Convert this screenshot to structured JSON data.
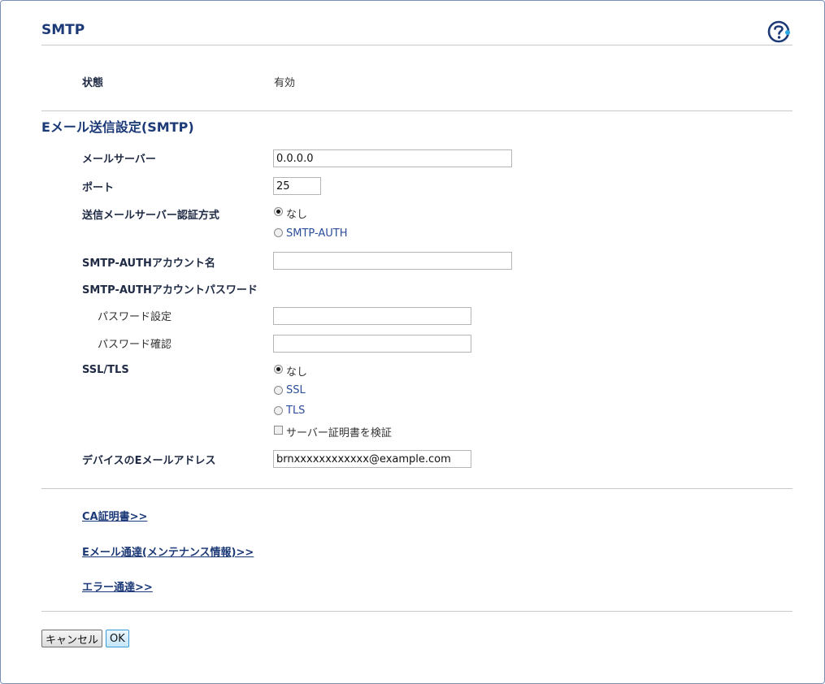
{
  "page": {
    "title": "SMTP",
    "help_icon": "help-question-icon"
  },
  "status": {
    "label": "状態",
    "value": "有効"
  },
  "section": {
    "title": "Eメール送信設定(SMTP)"
  },
  "form": {
    "mail_server": {
      "label": "メールサーバー",
      "value": "0.0.0.0"
    },
    "port": {
      "label": "ポート",
      "value": "25"
    },
    "auth_method": {
      "label": "送信メールサーバー認証方式",
      "options": [
        "なし",
        "SMTP-AUTH"
      ],
      "selected": "なし"
    },
    "auth_account": {
      "label": "SMTP-AUTHアカウント名",
      "value": ""
    },
    "auth_password": {
      "label": "SMTP-AUTHアカウントパスワード",
      "set_label": "パスワード設定",
      "confirm_label": "パスワード確認",
      "set_value": "",
      "confirm_value": ""
    },
    "ssl_tls": {
      "label": "SSL/TLS",
      "options": [
        "なし",
        "SSL",
        "TLS"
      ],
      "selected": "なし",
      "verify_cert_label": "サーバー証明書を検証",
      "verify_cert_checked": false
    },
    "device_email": {
      "label": "デバイスのEメールアドレス",
      "value": "brnxxxxxxxxxxxx@example.com"
    }
  },
  "links": {
    "ca_cert": "CA証明書>>",
    "email_report": "Eメール通達(メンテナンス情報)>>",
    "error_report": "エラー通達>>"
  },
  "buttons": {
    "cancel": "キャンセル",
    "ok": "OK"
  }
}
